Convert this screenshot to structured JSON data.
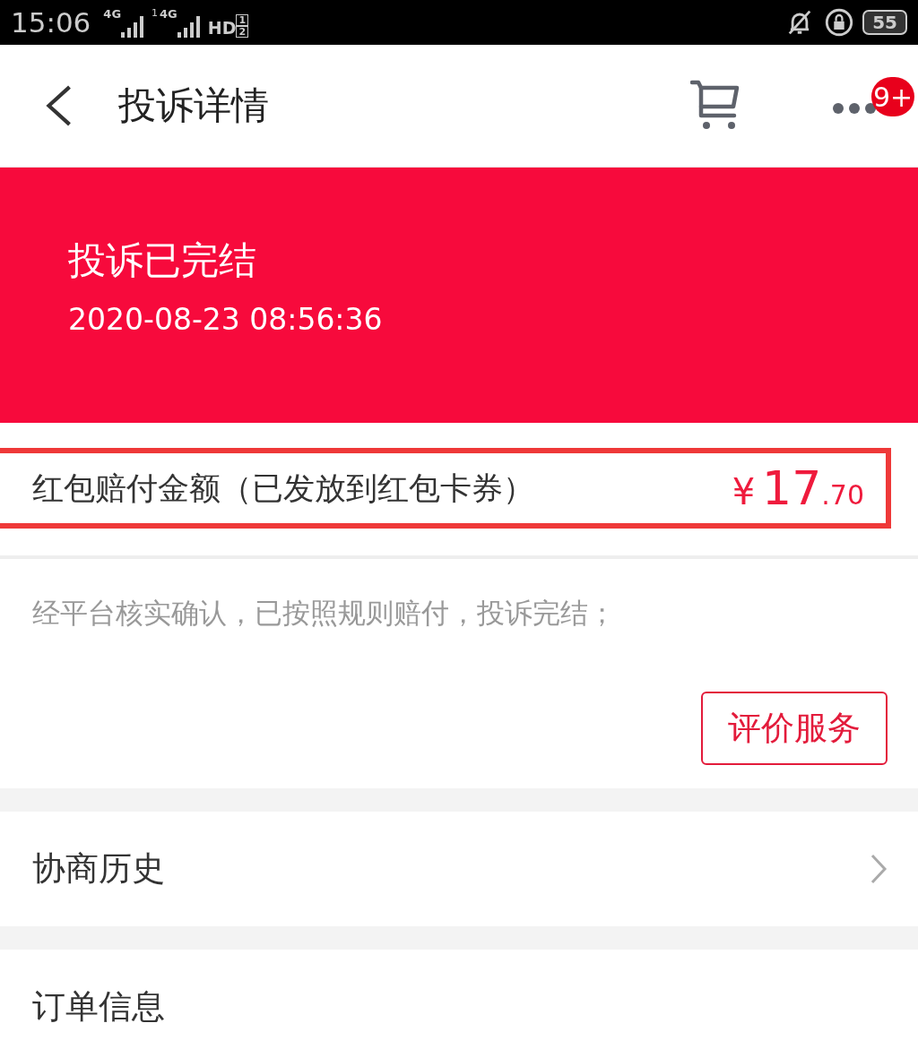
{
  "status_bar": {
    "time": "15:06",
    "signals": [
      {
        "label": "4G"
      },
      {
        "label": "4G",
        "roaming": "1"
      }
    ],
    "hd": {
      "label": "HD",
      "sims": [
        "1",
        "2"
      ]
    },
    "battery": "55"
  },
  "header": {
    "title": "投诉详情",
    "badge": "9+"
  },
  "banner": {
    "status": "投诉已完结",
    "time": "2020-08-23 08:56:36"
  },
  "compensation": {
    "label": "红包赔付金额（已发放到红包卡券）",
    "currency": "¥",
    "amount_int": "17",
    "amount_dec": ".70",
    "highlighted": true
  },
  "note": "经平台核实确认，已按照规则赔付，投诉完结；",
  "action_button": "评价服务",
  "sections": [
    {
      "title": "协商历史",
      "chevron": true
    },
    {
      "title": "订单信息",
      "chevron": false
    }
  ]
}
